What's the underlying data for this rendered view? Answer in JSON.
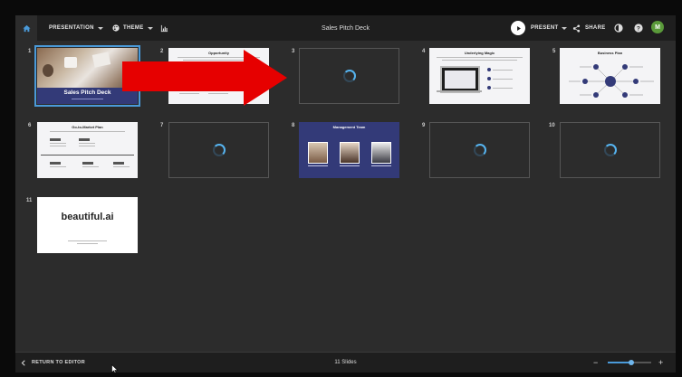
{
  "header": {
    "presentation_label": "PRESENTATION",
    "theme_label": "THEME",
    "deck_title": "Sales Pitch Deck",
    "present_label": "PRESENT",
    "share_label": "SHARE",
    "avatar_initial": "M"
  },
  "slides": [
    {
      "number": "1",
      "title": "Sales Pitch Deck",
      "state": "loaded"
    },
    {
      "number": "2",
      "title": "Opportunity",
      "state": "loaded"
    },
    {
      "number": "3",
      "title": "",
      "state": "loading"
    },
    {
      "number": "4",
      "title": "Underlying Magic",
      "state": "loaded"
    },
    {
      "number": "5",
      "title": "Business Plan",
      "state": "loaded"
    },
    {
      "number": "6",
      "title": "Go-to-Market Plan",
      "state": "loaded"
    },
    {
      "number": "7",
      "title": "",
      "state": "loading"
    },
    {
      "number": "8",
      "title": "Management Team",
      "state": "loaded"
    },
    {
      "number": "9",
      "title": "",
      "state": "loading"
    },
    {
      "number": "10",
      "title": "",
      "state": "loading"
    },
    {
      "number": "11",
      "title": "beautiful.ai",
      "state": "loaded"
    }
  ],
  "footer": {
    "return_label": "RETURN TO EDITOR",
    "slide_count": "11 Slides",
    "zoom_level": 0.55
  },
  "colors": {
    "accent": "#4a9ad9",
    "navy": "#333a78",
    "arrow": "#e60000",
    "avatar": "#5a9a3a"
  }
}
